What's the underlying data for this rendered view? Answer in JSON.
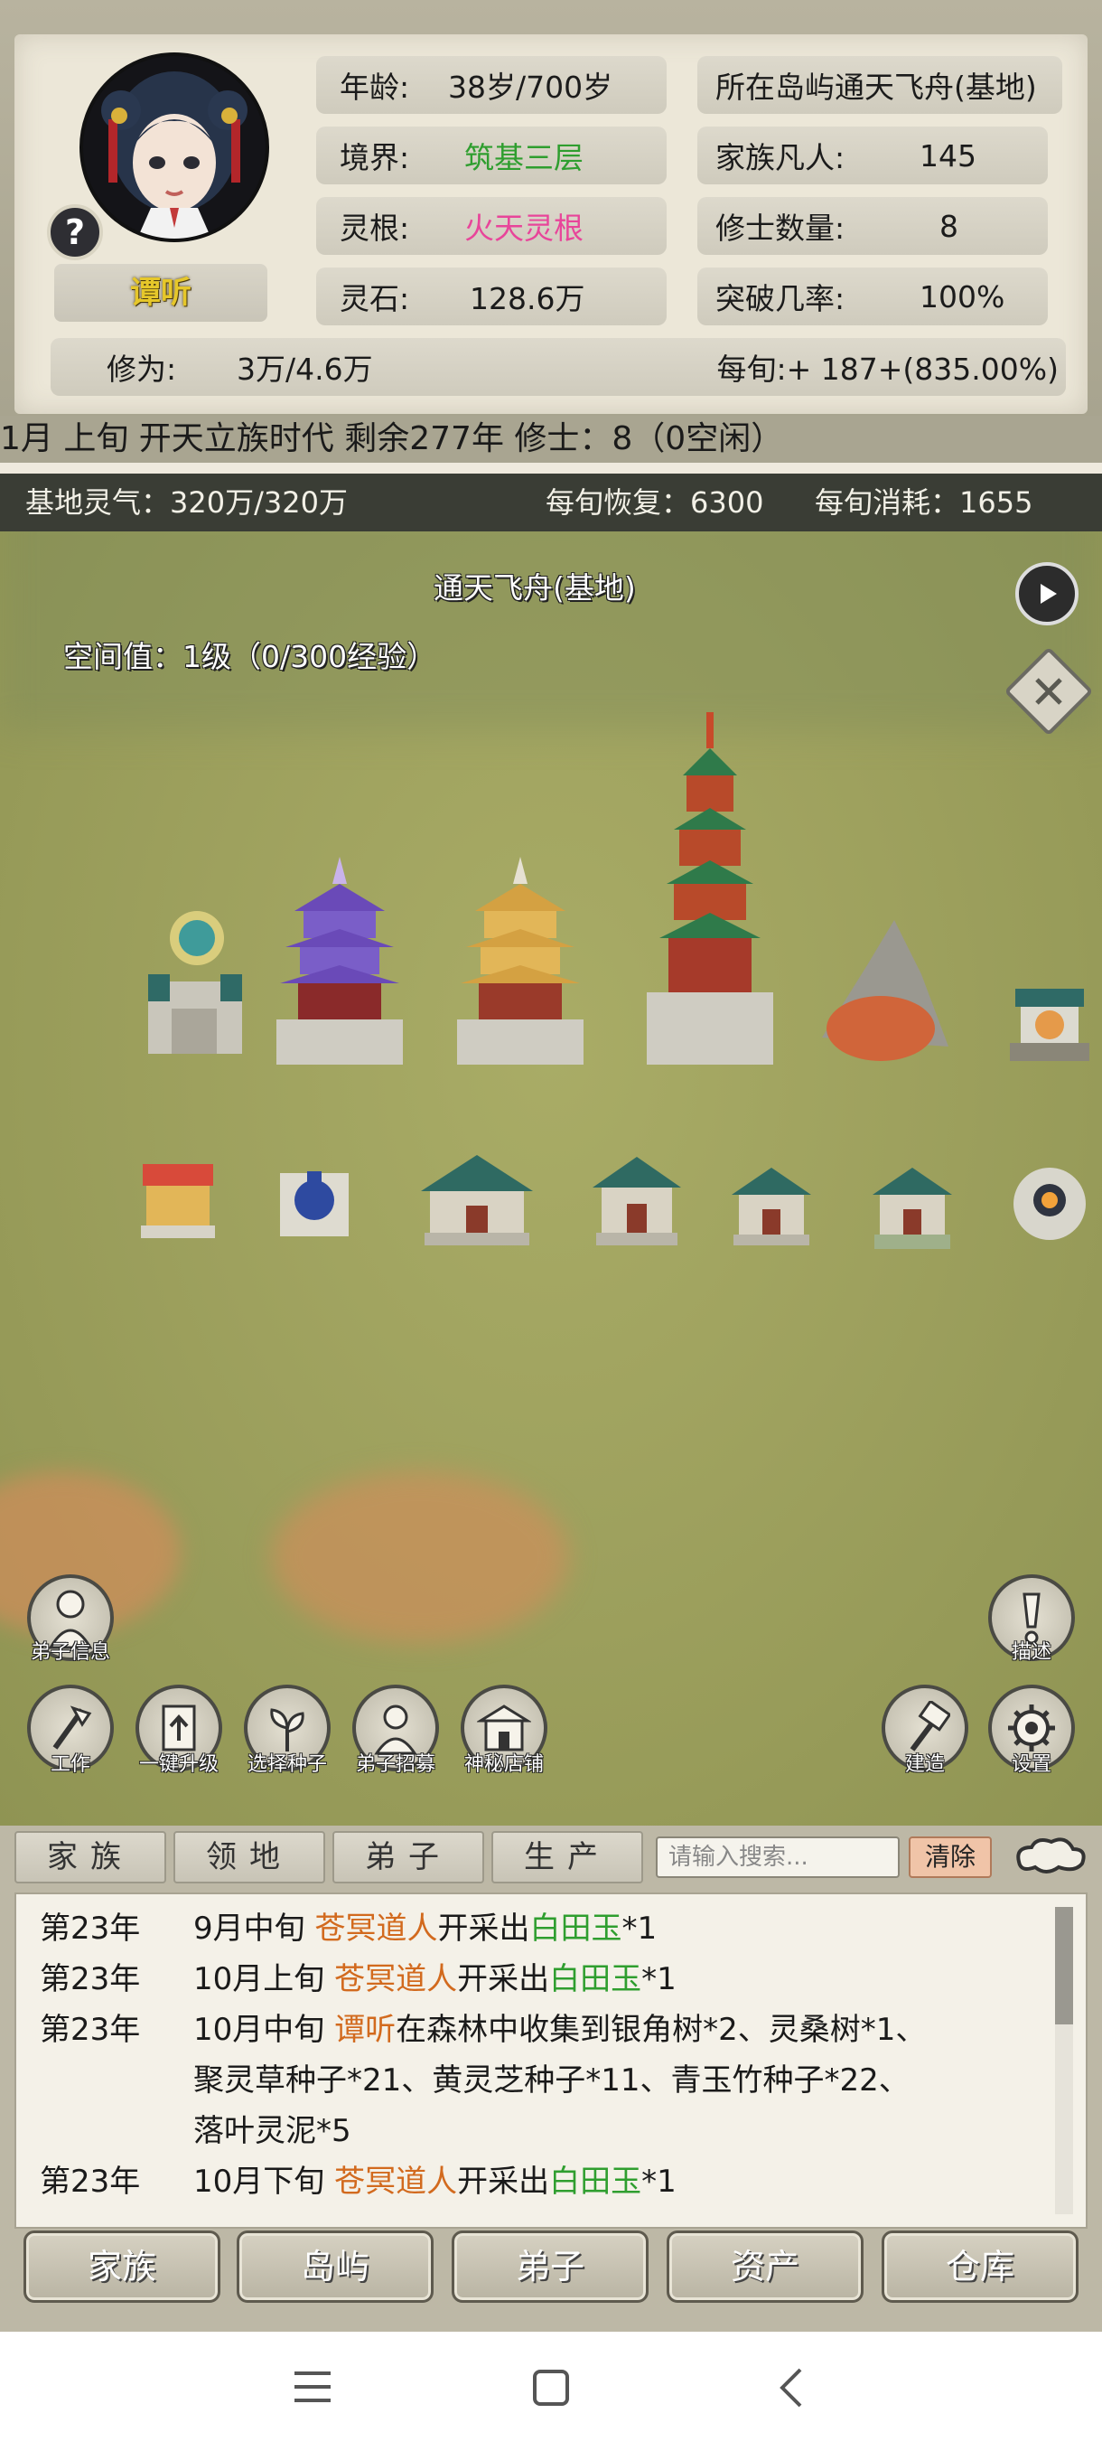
{
  "status": {
    "age_label": "年龄:",
    "age_value": "38岁/700岁",
    "realm_label": "境界:",
    "realm_value": "筑基三层",
    "root_label": "灵根:",
    "root_value": "火天灵根",
    "stones_label": "灵石:",
    "stones_value": "128.6万",
    "island_label": "所在岛屿",
    "island_value": "通天飞舟(基地)",
    "mortals_label": "家族凡人:",
    "mortals_value": "145",
    "cultivators_label": "修士数量:",
    "cultivators_value": "8",
    "breakthrough_label": "突破几率:",
    "breakthrough_value": "100%",
    "cultivation_label": "修为:",
    "cultivation_value": "3万/4.6万",
    "per_tick": "每旬:+ 187+(835.00%)",
    "character_name": "谭听",
    "help_symbol": "?"
  },
  "info_line": "1月 上旬  开天立族时代 剩余277年    修士：8（0空闲）",
  "qi_bar": {
    "base_qi": "基地灵气：320万/320万",
    "recover": "每旬恢复：6300",
    "consume": "每旬消耗：1655"
  },
  "map": {
    "title": "通天飞舟(基地)",
    "space_value": "空间值：1级（0/300经验）",
    "buttons": {
      "disciple_info": "弟子信息",
      "work": "工作",
      "upgrade_all": "一键升级",
      "select_seed": "选择种子",
      "recruit": "弟子招募",
      "shop": "神秘店铺",
      "describe": "描述",
      "build": "建造",
      "settings": "设置"
    }
  },
  "log": {
    "tabs": [
      "家族",
      "领地",
      "弟子",
      "生产"
    ],
    "search_placeholder": "请输入搜索...",
    "clear_label": "清除",
    "entries": [
      {
        "year": "第23年",
        "time": "9月中旬",
        "actor": "苍冥道人",
        "text": "开采出",
        "item": "白田玉",
        "suffix": "*1"
      },
      {
        "year": "第23年",
        "time": "10月上旬",
        "actor": "苍冥道人",
        "text": "开采出",
        "item": "白田玉",
        "suffix": "*1"
      },
      {
        "year": "第23年",
        "time": "10月中旬",
        "actor": "谭听",
        "text": "在森林中收集到银角树*2、灵桑树*1、",
        "item": "",
        "suffix": ""
      },
      {
        "year": "",
        "time": "聚灵草种子*21、黄灵芝种子*11、青玉竹种子*22、",
        "actor": "",
        "text": "",
        "item": "",
        "suffix": ""
      },
      {
        "year": "",
        "time": "落叶灵泥*5",
        "actor": "",
        "text": "",
        "item": "",
        "suffix": ""
      },
      {
        "year": "第23年",
        "time": "10月下旬",
        "actor": "苍冥道人",
        "text": "开采出",
        "item": "白田玉",
        "suffix": "*1"
      }
    ]
  },
  "bottom_nav": [
    "家族",
    "岛屿",
    "弟子",
    "资产",
    "仓库"
  ],
  "colors": {
    "realm": "#2f9e2f",
    "root": "#e8459a",
    "actor": "#d26a1e",
    "item": "#2f9e2f"
  }
}
